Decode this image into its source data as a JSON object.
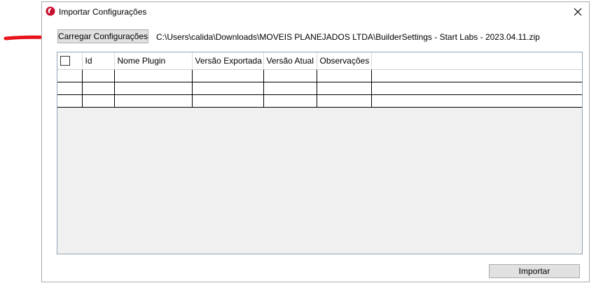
{
  "window": {
    "title": "Importar Configurações",
    "close_icon": "close-icon",
    "app_icon": "app-logo-icon"
  },
  "toolbar": {
    "load_button_label": "Carregar Configurações",
    "file_path": "C:\\Users\\calida\\Downloads\\MOVEIS PLANEJADOS LTDA\\BuilderSettings - Start Labs - 2023.04.11.zip"
  },
  "grid": {
    "columns": [
      "Id",
      "Nome Plugin",
      "Versão Exportada",
      "Versão Atual",
      "Observações"
    ],
    "rows": [
      [
        "",
        "",
        "",
        "",
        ""
      ],
      [
        "",
        "",
        "",
        "",
        ""
      ],
      [
        "",
        "",
        "",
        "",
        ""
      ]
    ]
  },
  "footer": {
    "import_button_label": "Importar"
  },
  "colors": {
    "annotation_arrow": "#e8141b",
    "button_face": "#e1e1e1",
    "grid_background": "#f0f0f0"
  }
}
